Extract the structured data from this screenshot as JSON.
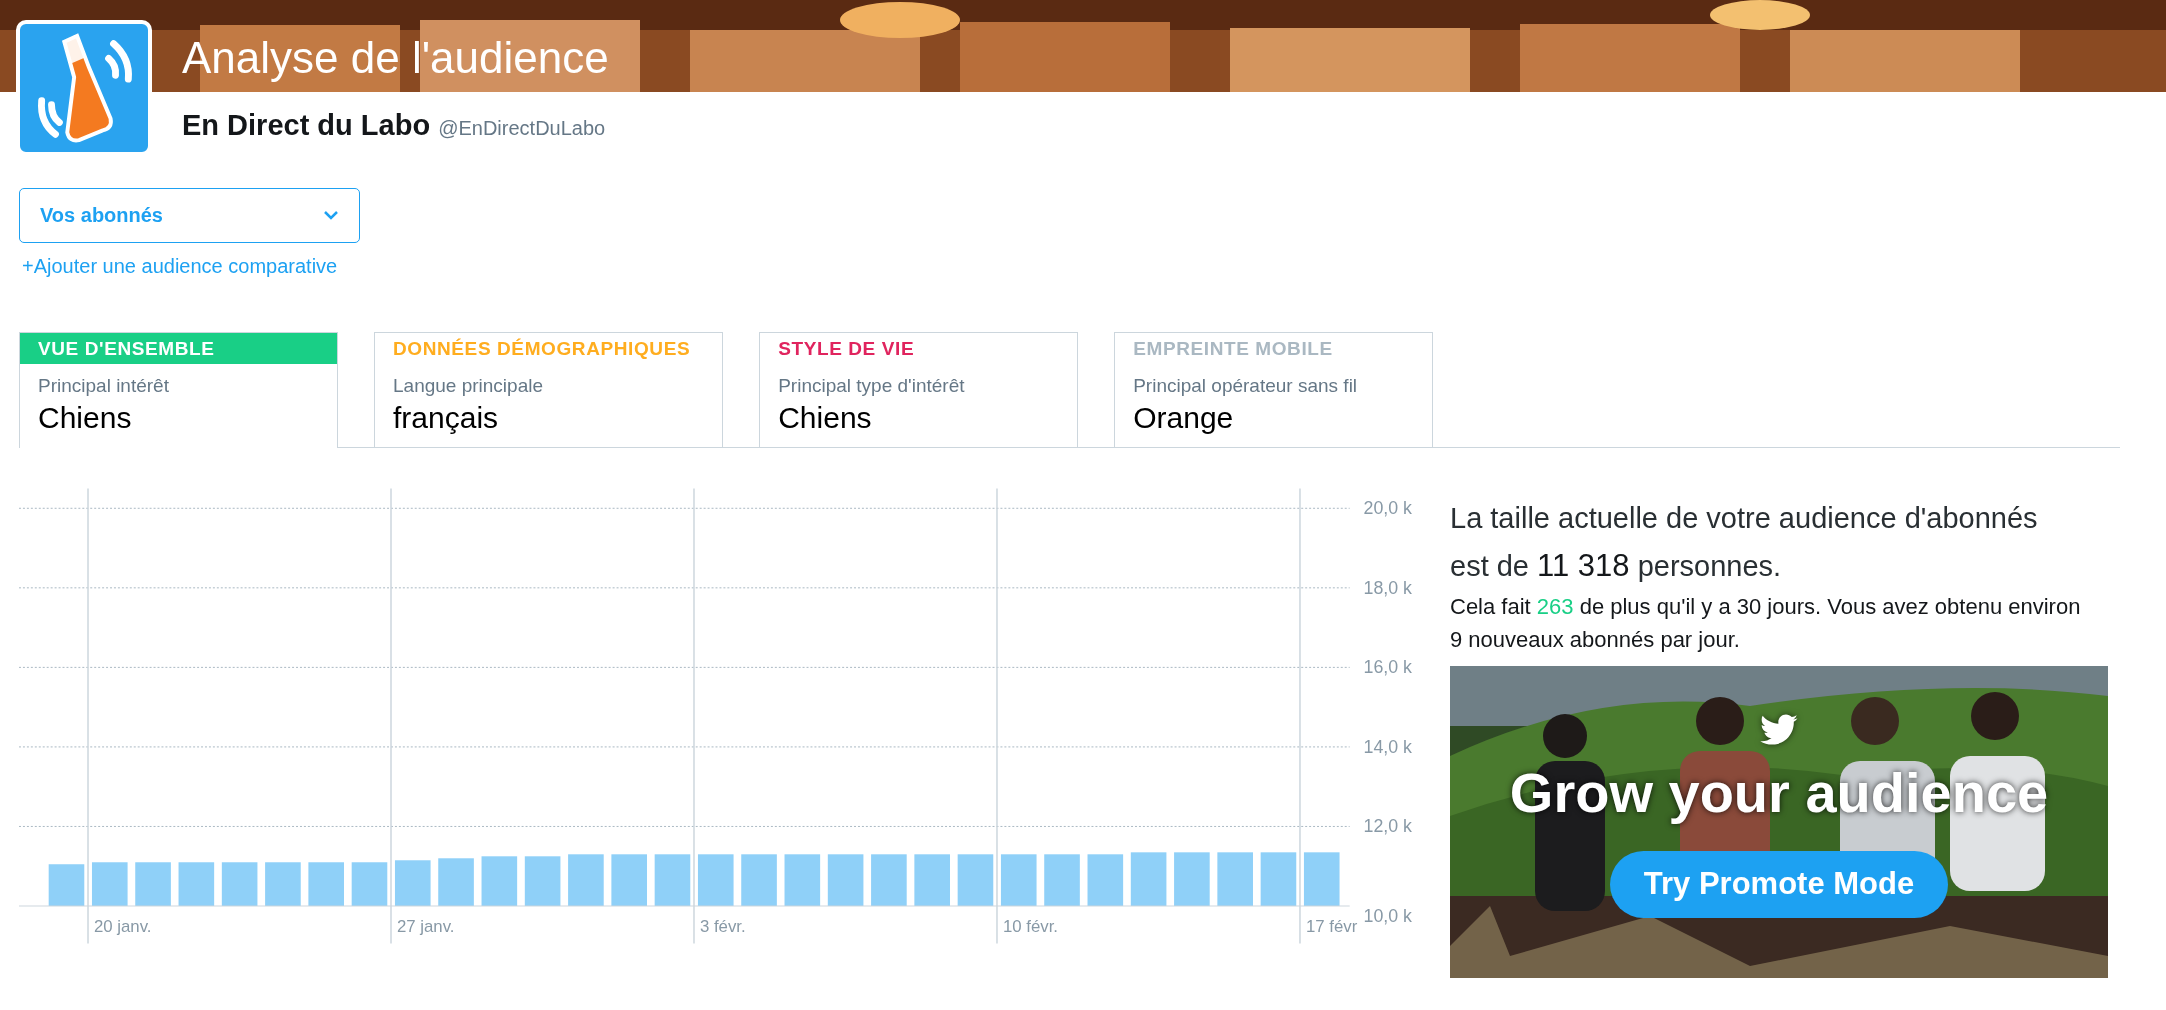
{
  "header": {
    "title": "Analyse de l'audience",
    "account_name": "En Direct du Labo",
    "handle": "@EnDirectDuLabo"
  },
  "audience_select": {
    "value": "Vos abonnés"
  },
  "add_comparison_link": "+Ajouter une audience comparative",
  "tabs": [
    {
      "label": "VUE D'ENSEMBLE",
      "color": "#19cf86",
      "subtitle": "Principal intérêt",
      "value": "Chiens",
      "selected": true
    },
    {
      "label": "DONNÉES DÉMOGRAPHIQUES",
      "color": "#ffad1f",
      "subtitle": "Langue principale",
      "value": "français",
      "selected": false
    },
    {
      "label": "STYLE DE VIE",
      "color": "#e0245e",
      "subtitle": "Principal type d'intérêt",
      "value": "Chiens",
      "selected": false
    },
    {
      "label": "EMPREINTE MOBILE",
      "color": "#aab8c2",
      "subtitle": "Principal opérateur sans fil",
      "value": "Orange",
      "selected": false
    }
  ],
  "chart": {
    "chart_data": {
      "type": "bar",
      "categories": [
        null,
        "20 janv.",
        null,
        null,
        null,
        null,
        null,
        null,
        "27 janv.",
        null,
        null,
        null,
        null,
        null,
        null,
        "3 févr.",
        null,
        null,
        null,
        null,
        null,
        null,
        "10 févr.",
        null,
        null,
        null,
        null,
        null,
        null,
        "17 févr"
      ],
      "values": [
        11050,
        11100,
        11100,
        11100,
        11100,
        11100,
        11100,
        11100,
        11150,
        11200,
        11250,
        11250,
        11300,
        11300,
        11300,
        11300,
        11300,
        11300,
        11300,
        11300,
        11300,
        11300,
        11300,
        11300,
        11300,
        11350,
        11350,
        11350,
        11350,
        11350
      ],
      "ylim": [
        10000,
        20000
      ],
      "grid": true,
      "yticks": [
        {
          "value": 10000,
          "label": "10,0 k"
        },
        {
          "value": 12000,
          "label": "12,0 k"
        },
        {
          "value": 14000,
          "label": "14,0 k"
        },
        {
          "value": 16000,
          "label": "16,0 k"
        },
        {
          "value": 18000,
          "label": "18,0 k"
        },
        {
          "value": 20000,
          "label": "20,0 k"
        }
      ]
    }
  },
  "summary": {
    "headline": "La taille actuelle de votre audience d'abonnés est de **11 318** personnes.",
    "growth_before": "Cela fait ",
    "growth_value": "263",
    "growth_after": " de plus qu'il y a 30 jours. Vous avez obtenu environ 9 nouveaux abonnés par jour."
  },
  "promo": {
    "headline": "Grow your audience",
    "button": "Try Promote Mode"
  }
}
